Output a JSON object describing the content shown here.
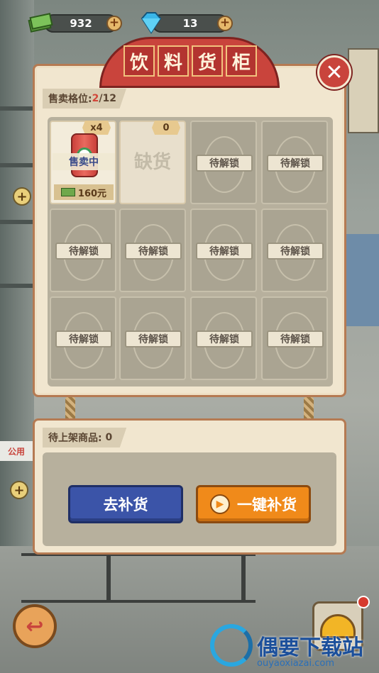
{
  "resources": {
    "cash": "932",
    "diamonds": "13"
  },
  "title_chars": [
    "饮",
    "料",
    "货",
    "柜"
  ],
  "slots": {
    "label": "售卖格位:",
    "used": "2",
    "total": "/12"
  },
  "cells": [
    {
      "state": "sold",
      "qty": "x4",
      "status": "售卖中",
      "price": "160元"
    },
    {
      "state": "empty",
      "qty": "0",
      "status": "缺货"
    },
    {
      "state": "locked",
      "label": "待解锁"
    },
    {
      "state": "locked",
      "label": "待解锁"
    },
    {
      "state": "locked",
      "label": "待解锁"
    },
    {
      "state": "locked",
      "label": "待解锁"
    },
    {
      "state": "locked",
      "label": "待解锁"
    },
    {
      "state": "locked",
      "label": "待解锁"
    },
    {
      "state": "locked",
      "label": "待解锁"
    },
    {
      "state": "locked",
      "label": "待解锁"
    },
    {
      "state": "locked",
      "label": "待解锁"
    },
    {
      "state": "locked",
      "label": "待解锁"
    }
  ],
  "pending": {
    "label": "待上架商品:",
    "count": "0"
  },
  "buttons": {
    "restock": "去补货",
    "one_key_restock": "一键补货"
  },
  "background": {
    "phone_sign": "公用"
  },
  "watermark": {
    "text": "偶要下载站",
    "url": "ouyaoxiazai.com"
  },
  "icons": {
    "close": "close-icon",
    "back": "back-arrow-icon",
    "plus": "plus-icon",
    "play": "play-icon",
    "helmet": "helmet-icon",
    "cash": "cash-icon",
    "diamond": "diamond-icon"
  },
  "colors": {
    "panel": "#f1e6cf",
    "banner_red": "#c9443c",
    "restock_blue": "#3b54a8",
    "one_key_orange": "#f08a1a"
  }
}
